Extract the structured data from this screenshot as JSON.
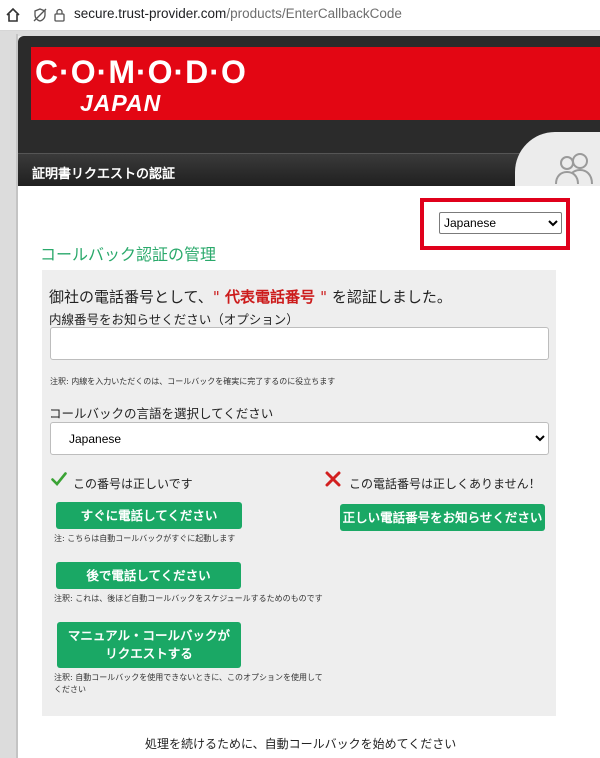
{
  "browser": {
    "url_host": "secure.trust-provider.com",
    "url_path": "/products/EnterCallbackCode",
    "icons": [
      "home-icon",
      "not-secure-icon",
      "lock-icon"
    ]
  },
  "header": {
    "logo_line1": "C·O·M·O·D·O",
    "logo_line2": "JAPAN",
    "section_title": "証明書リクエストの認証",
    "icon": "users-icon",
    "brand_color": "#e30613"
  },
  "language_select": {
    "selected": "Japanese"
  },
  "page_title": "コールバック認証の管理",
  "verification": {
    "prefix": "御社の電話番号として、",
    "quote_open": "\"",
    "highlight": " 代表電話番号 ",
    "quote_close": "\"",
    "suffix": " を認証しました。"
  },
  "extension": {
    "label": "内線番号をお知らせください（オプション）",
    "value": "",
    "note": "注釈: 内線を入力いただくのは、コールバックを確実に完了するのに役立ちます"
  },
  "callback_language": {
    "label": "コールバックの言語を選択してください",
    "selected": "Japanese"
  },
  "correct": {
    "label": "この番号は正しいです",
    "call_now_button": "すぐに電話してください",
    "call_now_note": "注: こちらは自動コールバックがすぐに起動します",
    "call_later_button": "後で電話してください",
    "call_later_note": "注釈: これは、後ほど自動コールバックをスケジュールするためのものです",
    "manual_button": "マニュアル・コールバックがリクエストする",
    "manual_note": "注釈: 自動コールバックを使用できないときに、このオプションを使用してください"
  },
  "incorrect": {
    "label": "この電話番号は正しくありません！",
    "button": "正しい電話番号をお知らせください"
  },
  "footer_text": "処理を続けるために、自動コールバックを始めてください",
  "colors": {
    "accent_green": "#1aa865",
    "title_green": "#2aa96b",
    "highlight_red": "#cc1b1b",
    "annotation_red": "#e0001b"
  }
}
